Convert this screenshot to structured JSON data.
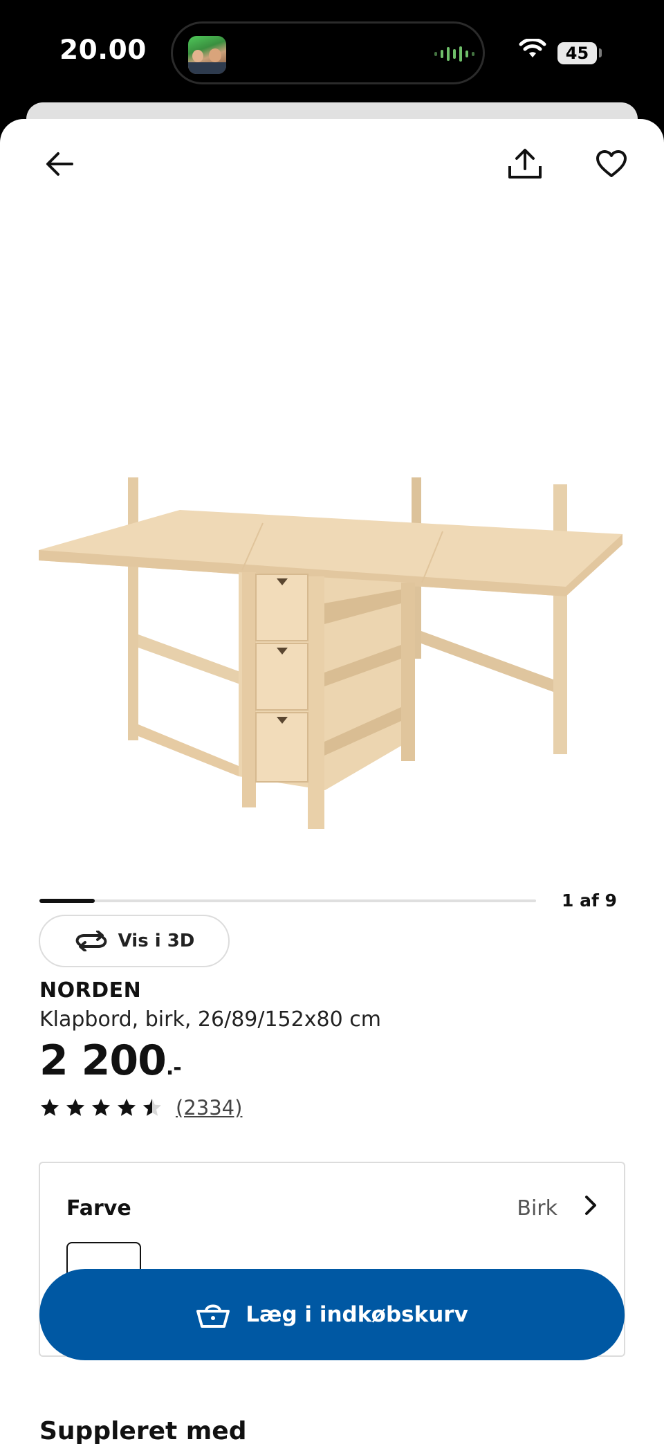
{
  "status_bar": {
    "time": "20.00",
    "battery": "45"
  },
  "header": {
    "back_icon": "arrow-left-icon",
    "share_icon": "share-icon",
    "favorite_icon": "heart-icon"
  },
  "gallery": {
    "view_3d_label": "Vis i 3D",
    "pager_text": "1 af 9",
    "progress": 0.111
  },
  "product": {
    "name": "NORDEN",
    "description": "Klapbord, birk, 26/89/152x80 cm",
    "price": "2 200",
    "price_suffix": ".-",
    "rating": 4.5,
    "review_count": "(2334)"
  },
  "color_selector": {
    "title": "Farve",
    "value": "Birk"
  },
  "cart_button": {
    "label": "Læg i indkøbskurv",
    "icon": "basket-icon",
    "color": "#0058a3"
  },
  "section": {
    "title": "Suppleret med"
  }
}
